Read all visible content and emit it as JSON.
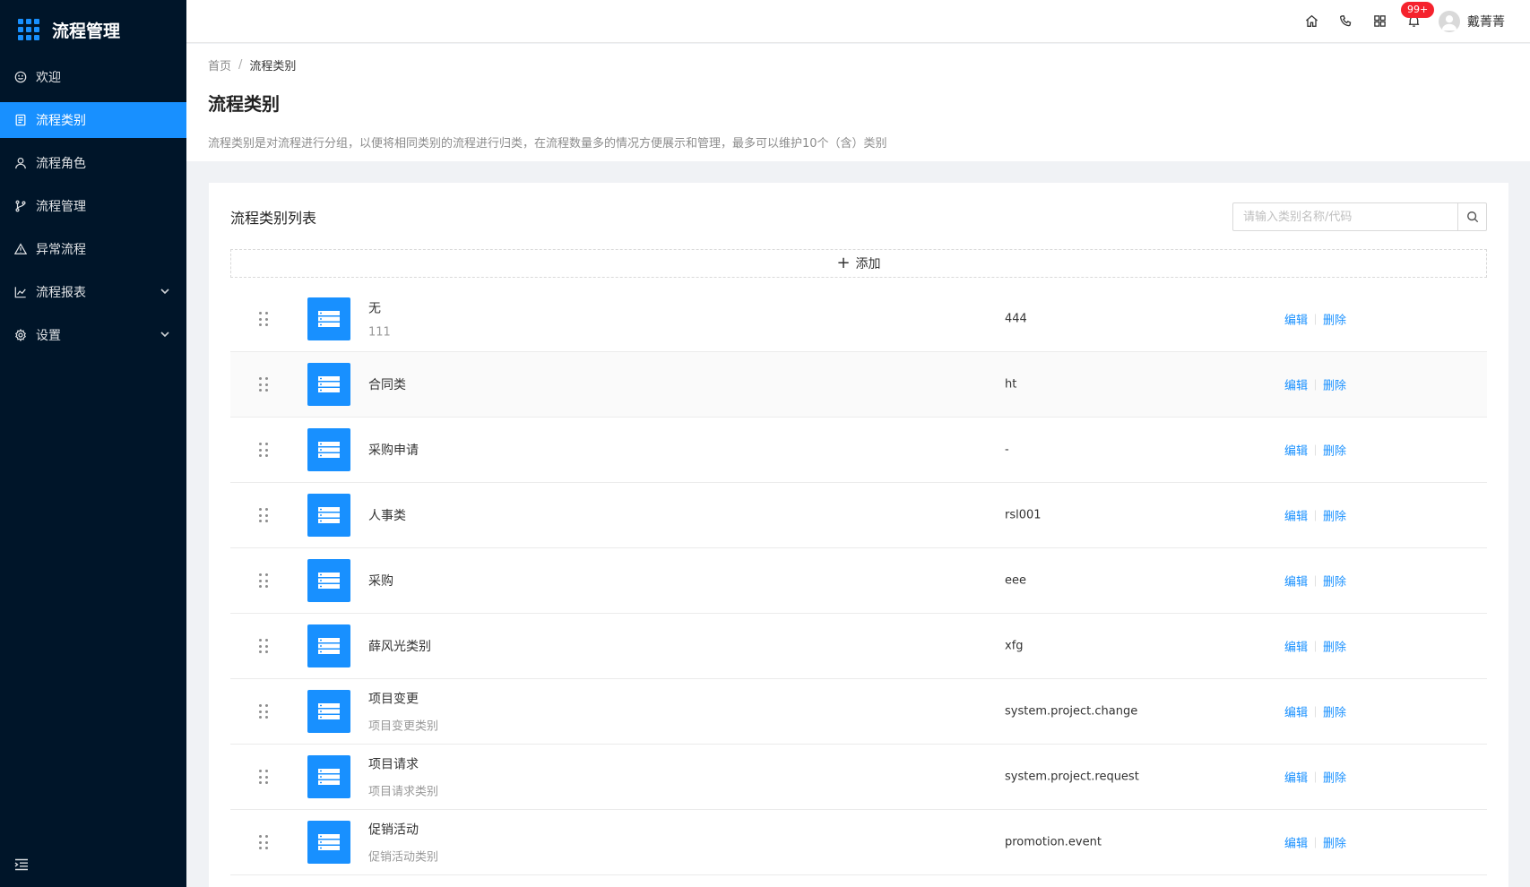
{
  "app": {
    "title": "流程管理"
  },
  "sidebar": {
    "items": [
      {
        "label": "欢迎",
        "icon": "smile-icon",
        "active": false
      },
      {
        "label": "流程类别",
        "icon": "file-list-icon",
        "active": true
      },
      {
        "label": "流程角色",
        "icon": "user-icon",
        "active": false
      },
      {
        "label": "流程管理",
        "icon": "branch-icon",
        "active": false
      },
      {
        "label": "异常流程",
        "icon": "warning-icon",
        "active": false
      },
      {
        "label": "流程报表",
        "icon": "line-chart-icon",
        "active": false,
        "expandable": true
      },
      {
        "label": "设置",
        "icon": "gear-icon",
        "active": false,
        "expandable": true
      }
    ]
  },
  "header": {
    "notification_badge": "99+",
    "user_name": "戴菁菁"
  },
  "breadcrumb": {
    "home": "首页",
    "current": "流程类别"
  },
  "page": {
    "title": "流程类别",
    "description": "流程类别是对流程进行分组，以便将相同类别的流程进行归类，在流程数量多的情况方便展示和管理，最多可以维护10个（含）类别"
  },
  "card": {
    "title": "流程类别列表",
    "search_placeholder": "请输入类别名称/代码",
    "add_label": "添加",
    "edit_label": "编辑",
    "delete_label": "删除"
  },
  "rows": [
    {
      "name": "无",
      "sub": "111",
      "code": "444"
    },
    {
      "name": "合同类",
      "sub": "",
      "code": "ht"
    },
    {
      "name": "采购申请",
      "sub": "",
      "code": "-"
    },
    {
      "name": "人事类",
      "sub": "",
      "code": "rsl001"
    },
    {
      "name": "采购",
      "sub": "",
      "code": "eee"
    },
    {
      "name": "薛风光类别",
      "sub": "",
      "code": "xfg"
    },
    {
      "name": "项目变更",
      "sub": "项目变更类别",
      "code": "system.project.change"
    },
    {
      "name": "项目请求",
      "sub": "项目请求类别",
      "code": "system.project.request"
    },
    {
      "name": "促销活动",
      "sub": "促销活动类别",
      "code": "promotion.event"
    }
  ],
  "colors": {
    "sidebar_bg": "#001529",
    "accent": "#1890ff",
    "badge": "#f5222d"
  }
}
